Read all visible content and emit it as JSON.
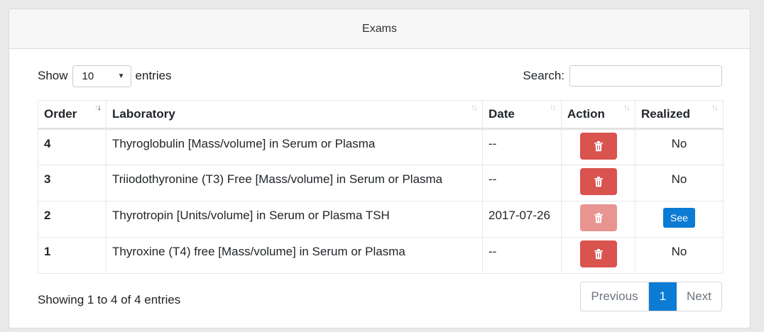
{
  "card": {
    "title": "Exams"
  },
  "length": {
    "show_label": "Show",
    "value": "10",
    "entries_label": "entries"
  },
  "search": {
    "label": "Search:",
    "value": ""
  },
  "table": {
    "headers": [
      "Order",
      "Laboratory",
      "Date",
      "Action",
      "Realized"
    ],
    "rows": [
      {
        "order": "4",
        "laboratory": "Thyroglobulin [Mass/volume] in Serum or Plasma",
        "date": "--",
        "realized": "No"
      },
      {
        "order": "3",
        "laboratory": "Triiodothyronine (T3) Free [Mass/volume] in Serum or Plasma",
        "date": "--",
        "realized": "No"
      },
      {
        "order": "2",
        "laboratory": "Thyrotropin [Units/volume] in Serum or Plasma TSH",
        "date": "2017-07-26",
        "realized": "See"
      },
      {
        "order": "1",
        "laboratory": "Thyroxine (T4) free [Mass/volume] in Serum or Plasma",
        "date": "--",
        "realized": "No"
      }
    ]
  },
  "info": "Showing 1 to 4 of 4 entries",
  "pagination": {
    "previous": "Previous",
    "current": "1",
    "next": "Next"
  },
  "colors": {
    "danger": "#d9534f",
    "danger_disabled": "#e89592",
    "primary": "#0b7bd4"
  },
  "icons": {
    "sort": "sort-arrows-icon",
    "delete": "trash-icon",
    "dropdown": "caret-down-icon"
  }
}
